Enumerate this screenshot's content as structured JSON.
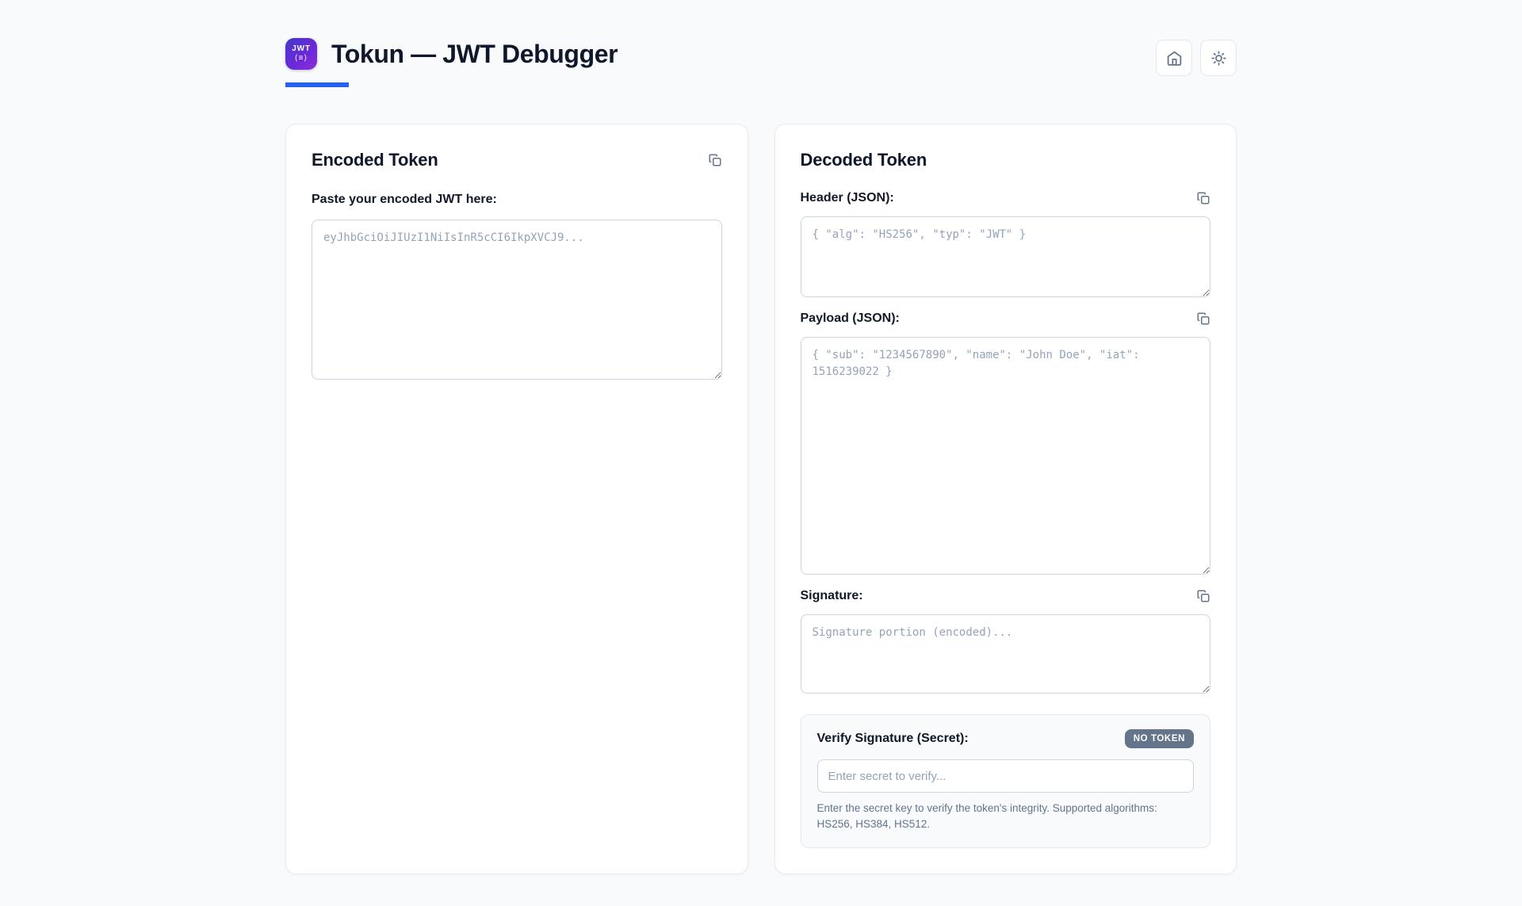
{
  "header": {
    "logo": {
      "line1": "JWT",
      "line2": "⟨≡⟩"
    },
    "title": "Tokun — JWT Debugger",
    "actions": {
      "home": "home-icon",
      "theme": "sun-icon"
    }
  },
  "encoded_panel": {
    "title": "Encoded Token",
    "label": "Paste your encoded JWT here:",
    "placeholder": "eyJhbGciOiJIUzI1NiIsInR5cCI6IkpXVCJ9..."
  },
  "decoded_panel": {
    "title": "Decoded Token",
    "sections": [
      {
        "label": "Header (JSON):",
        "placeholder": "{ \"alg\": \"HS256\", \"typ\": \"JWT\" }"
      },
      {
        "label": "Payload (JSON):",
        "placeholder": "{ \"sub\": \"1234567890\", \"name\": \"John Doe\", \"iat\": 1516239022 }"
      },
      {
        "label": "Signature:",
        "placeholder": "Signature portion (encoded)..."
      }
    ],
    "verify": {
      "label": "Verify Signature (Secret):",
      "badge": "NO TOKEN",
      "input_placeholder": "Enter secret to verify...",
      "help": "Enter the secret key to verify the token's integrity. Supported algorithms: HS256, HS384, HS512."
    }
  },
  "colors": {
    "accent": "#2563eb",
    "logo_gradient_start": "#4338ca",
    "logo_gradient_end": "#8b2fd6",
    "badge_bg": "#64748b",
    "page_bg": "#f8fafc"
  }
}
